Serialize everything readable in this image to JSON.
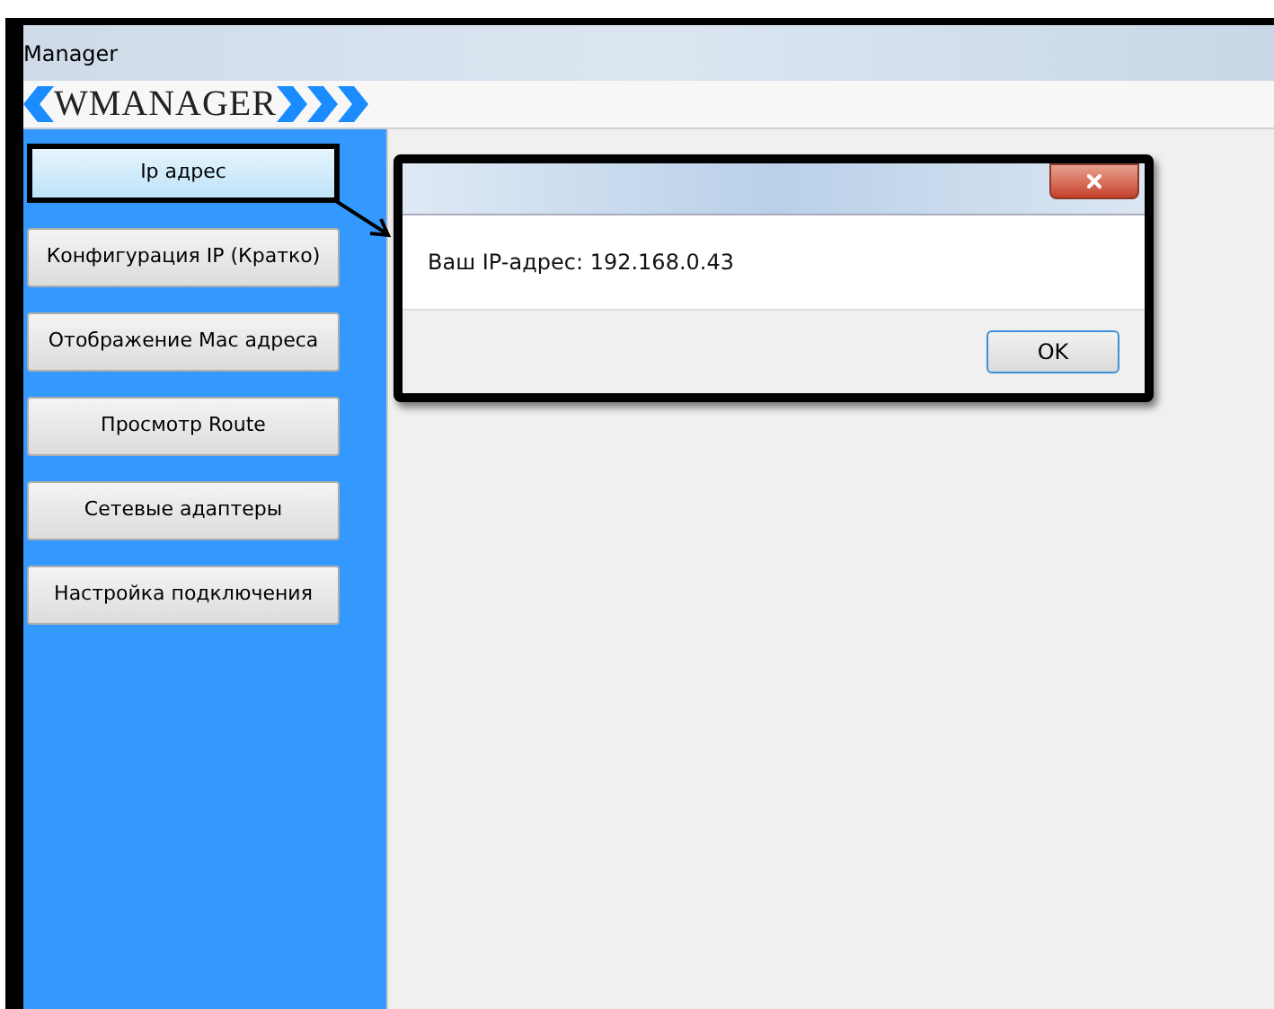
{
  "window": {
    "title": "Manager"
  },
  "logo": {
    "text": "WMANAGER"
  },
  "sidebar": {
    "buttons": [
      {
        "label": "Ip адрес",
        "selected": true
      },
      {
        "label": "Конфигурация IP (Кратко)",
        "selected": false
      },
      {
        "label": "Отображение Mac адреса",
        "selected": false
      },
      {
        "label": "Просмотр Route",
        "selected": false
      },
      {
        "label": "Сетевые адаптеры",
        "selected": false
      },
      {
        "label": "Настройка подключения",
        "selected": false
      }
    ]
  },
  "dialog": {
    "message": "Ваш IP-адрес: 192.168.0.43",
    "buttons": [
      "OK"
    ]
  }
}
